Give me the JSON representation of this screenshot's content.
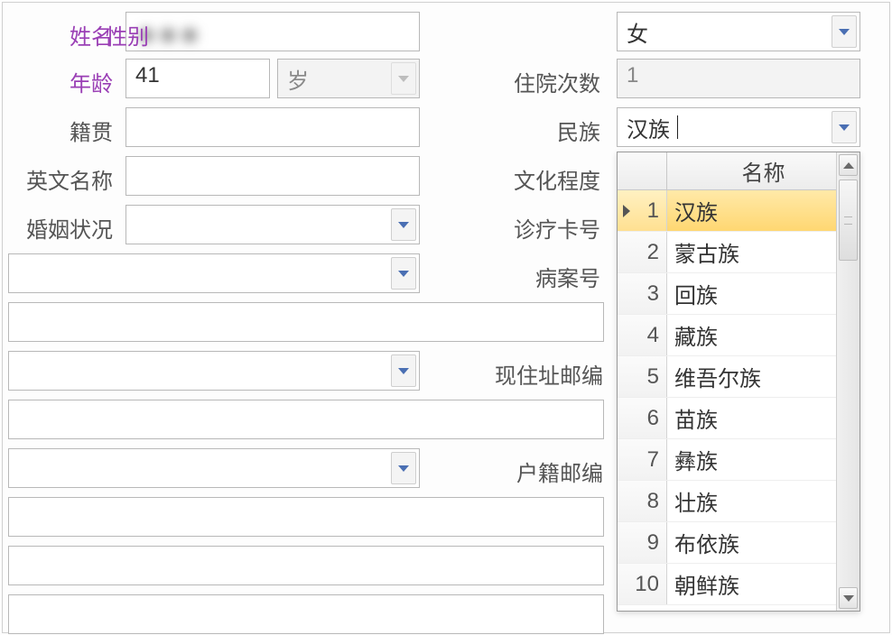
{
  "labels": {
    "name": "姓名",
    "gender": "性别",
    "age": "年龄",
    "ageUnit": "岁",
    "admitCount": "住院次数",
    "nativePlace": "籍贯",
    "ethnic": "民族",
    "englishName": "英文名称",
    "education": "文化程度",
    "marital": "婚姻状况",
    "cardNo": "诊疗卡号",
    "medicalRecordNo": "病案号",
    "currentZip": "现住址邮编",
    "registeredZip": "户籍邮编"
  },
  "values": {
    "gender": "女",
    "age": "41",
    "admitCount": "1",
    "ethnic": "汉族"
  },
  "dropdown": {
    "headerName": "名称",
    "options": [
      "汉族",
      "蒙古族",
      "回族",
      "藏族",
      "维吾尔族",
      "苗族",
      "彝族",
      "壮族",
      "布依族",
      "朝鲜族"
    ],
    "selectedIndex": 0
  }
}
